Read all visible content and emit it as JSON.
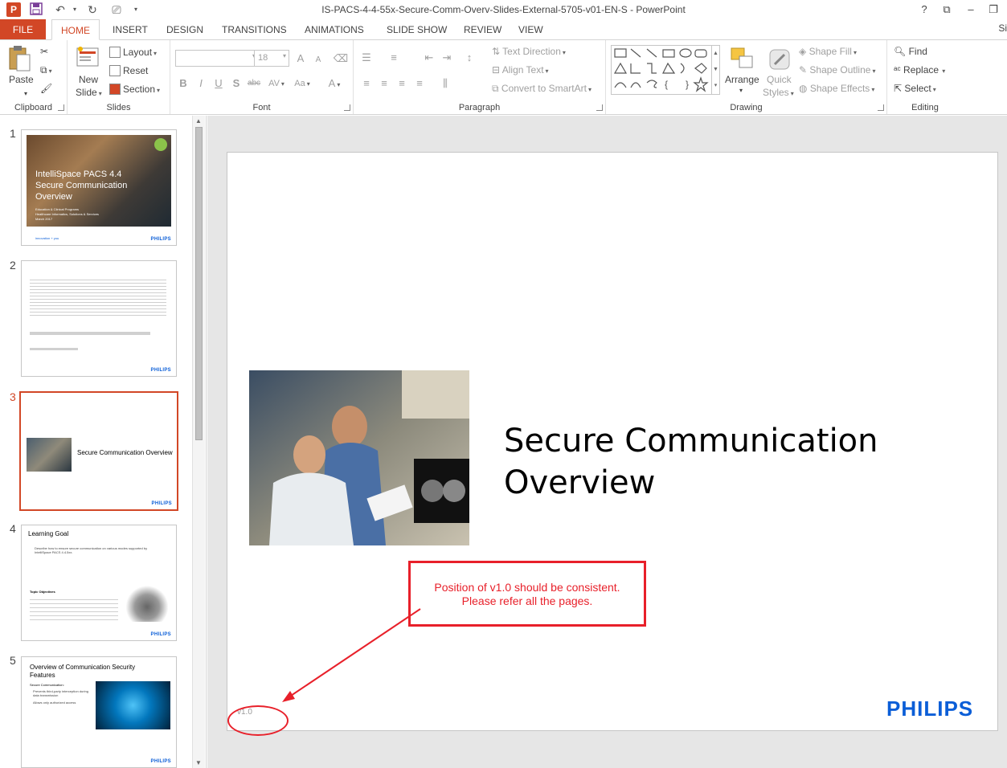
{
  "titlebar": {
    "doc_title": "IS-PACS-4-4-55x-Secure-Comm-Overv-Slides-External-5705-v01-EN-S - PowerPoint",
    "app_logo": "P",
    "help": "?"
  },
  "tabs": {
    "file": "FILE",
    "home": "HOME",
    "insert": "INSERT",
    "design": "DESIGN",
    "transitions": "TRANSITIONS",
    "animations": "ANIMATIONS",
    "slideshow": "SLIDE SHOW",
    "review": "REVIEW",
    "view": "VIEW",
    "signin": "Si"
  },
  "ribbon": {
    "clipboard": {
      "label": "Clipboard",
      "paste": "Paste"
    },
    "slides": {
      "label": "Slides",
      "new_slide_1": "New",
      "new_slide_2": "Slide",
      "layout": "Layout",
      "reset": "Reset",
      "section": "Section"
    },
    "font": {
      "label": "Font",
      "font_size": "18",
      "bold": "B",
      "italic": "I",
      "underline": "U",
      "shadow": "S",
      "strike": "abc",
      "spacing": "AV",
      "case": "Aa",
      "color": "A",
      "grow": "A",
      "shrink": "A"
    },
    "paragraph": {
      "label": "Paragraph",
      "text_direction": "Text Direction",
      "align_text": "Align Text",
      "convert_smartart": "Convert to SmartArt"
    },
    "drawing": {
      "label": "Drawing",
      "arrange": "Arrange",
      "quick_styles_1": "Quick",
      "quick_styles_2": "Styles",
      "shape_fill": "Shape Fill",
      "shape_outline": "Shape Outline",
      "shape_effects": "Shape Effects"
    },
    "editing": {
      "label": "Editing",
      "find": "Find",
      "replace": "Replace",
      "select": "Select"
    }
  },
  "thumbnails": [
    {
      "num": "1",
      "title": "IntelliSpace PACS 4.4 Secure Communication Overview",
      "sub1": "Education & Clinical Programs",
      "sub2": "Healthcare Informatics, Solutions & Services",
      "sub3": "March 2017",
      "tagline": "innovation + you",
      "brand": "PHILIPS"
    },
    {
      "num": "2",
      "brand": "PHILIPS"
    },
    {
      "num": "3",
      "title": "Secure Communication Overview",
      "brand": "PHILIPS"
    },
    {
      "num": "4",
      "title": "Learning Goal",
      "bullet1": "Describe how to ensure secure communication on various modes supported by IntelliSpace PACS 4.4.5xx.",
      "objectives": "Topic Objectives",
      "brand": "PHILIPS"
    },
    {
      "num": "5",
      "title": "Overview of Communication Security Features",
      "sub": "Secure Communication:",
      "bullet1": "Prevents third-party interception during data transmission",
      "bullet2": "Allows only authorized access",
      "brand": "PHILIPS"
    }
  ],
  "slide": {
    "title": "Secure Communication Overview",
    "brand": "PHILIPS",
    "version": "v1.0"
  },
  "annotation": {
    "line1": "Position of v1.0 should be consistent.",
    "line2": "Please refer all the pages.",
    "color": "#e8202a"
  },
  "colors": {
    "accent": "#d24726",
    "philips_blue": "#0b5ed7"
  }
}
